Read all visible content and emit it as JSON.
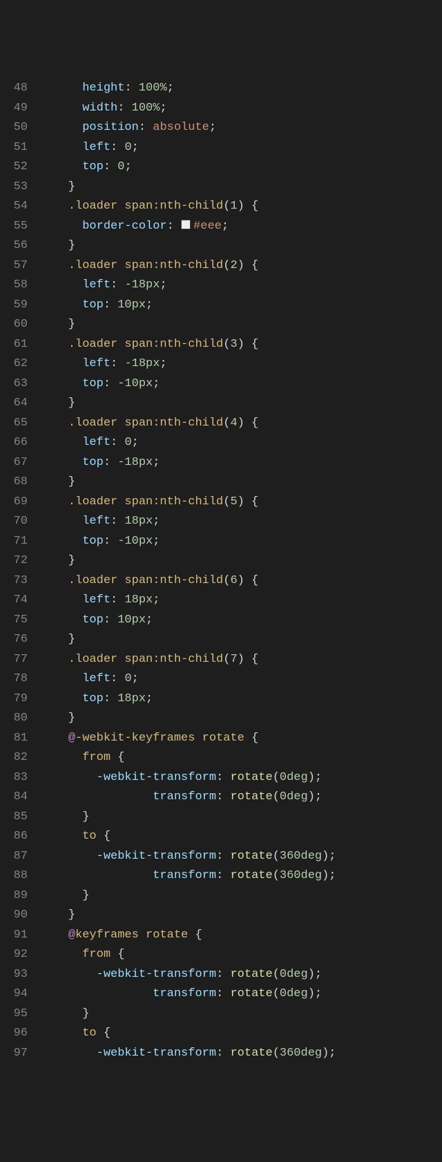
{
  "lines": [
    {
      "n": 48,
      "tokens": [
        {
          "t": "      ",
          "c": "punc"
        },
        {
          "t": "height",
          "c": "prop"
        },
        {
          "t": ": ",
          "c": "punc"
        },
        {
          "t": "100",
          "c": "num"
        },
        {
          "t": "%",
          "c": "unit"
        },
        {
          "t": ";",
          "c": "punc"
        }
      ]
    },
    {
      "n": 49,
      "tokens": [
        {
          "t": "      ",
          "c": "punc"
        },
        {
          "t": "width",
          "c": "prop"
        },
        {
          "t": ": ",
          "c": "punc"
        },
        {
          "t": "100",
          "c": "num"
        },
        {
          "t": "%",
          "c": "unit"
        },
        {
          "t": ";",
          "c": "punc"
        }
      ]
    },
    {
      "n": 50,
      "tokens": [
        {
          "t": "      ",
          "c": "punc"
        },
        {
          "t": "position",
          "c": "prop"
        },
        {
          "t": ": ",
          "c": "punc"
        },
        {
          "t": "absolute",
          "c": "val"
        },
        {
          "t": ";",
          "c": "punc"
        }
      ]
    },
    {
      "n": 51,
      "tokens": [
        {
          "t": "      ",
          "c": "punc"
        },
        {
          "t": "left",
          "c": "prop"
        },
        {
          "t": ": ",
          "c": "punc"
        },
        {
          "t": "0",
          "c": "num"
        },
        {
          "t": ";",
          "c": "punc"
        }
      ]
    },
    {
      "n": 52,
      "tokens": [
        {
          "t": "      ",
          "c": "punc"
        },
        {
          "t": "top",
          "c": "prop"
        },
        {
          "t": ": ",
          "c": "punc"
        },
        {
          "t": "0",
          "c": "num"
        },
        {
          "t": ";",
          "c": "punc"
        }
      ]
    },
    {
      "n": 53,
      "tokens": [
        {
          "t": "    }",
          "c": "punc"
        }
      ]
    },
    {
      "n": 54,
      "tokens": [
        {
          "t": "    ",
          "c": "punc"
        },
        {
          "t": ".loader span:nth-child",
          "c": "sel"
        },
        {
          "t": "(",
          "c": "punc"
        },
        {
          "t": "1",
          "c": "num"
        },
        {
          "t": ")",
          "c": "punc"
        },
        {
          "t": " {",
          "c": "punc"
        }
      ]
    },
    {
      "n": 55,
      "tokens": [
        {
          "t": "      ",
          "c": "punc"
        },
        {
          "t": "border-color",
          "c": "prop"
        },
        {
          "t": ": ",
          "c": "punc"
        },
        {
          "t": "",
          "c": "colorbox"
        },
        {
          "t": "#eee",
          "c": "hex"
        },
        {
          "t": ";",
          "c": "punc"
        }
      ]
    },
    {
      "n": 56,
      "tokens": [
        {
          "t": "    }",
          "c": "punc"
        }
      ]
    },
    {
      "n": 57,
      "tokens": [
        {
          "t": "    ",
          "c": "punc"
        },
        {
          "t": ".loader span:nth-child",
          "c": "sel"
        },
        {
          "t": "(",
          "c": "punc"
        },
        {
          "t": "2",
          "c": "num"
        },
        {
          "t": ")",
          "c": "punc"
        },
        {
          "t": " {",
          "c": "punc"
        }
      ]
    },
    {
      "n": 58,
      "tokens": [
        {
          "t": "      ",
          "c": "punc"
        },
        {
          "t": "left",
          "c": "prop"
        },
        {
          "t": ": ",
          "c": "punc"
        },
        {
          "t": "-18",
          "c": "num"
        },
        {
          "t": "px",
          "c": "unit"
        },
        {
          "t": ";",
          "c": "punc"
        }
      ]
    },
    {
      "n": 59,
      "tokens": [
        {
          "t": "      ",
          "c": "punc"
        },
        {
          "t": "top",
          "c": "prop"
        },
        {
          "t": ": ",
          "c": "punc"
        },
        {
          "t": "10",
          "c": "num"
        },
        {
          "t": "px",
          "c": "unit"
        },
        {
          "t": ";",
          "c": "punc"
        }
      ]
    },
    {
      "n": 60,
      "tokens": [
        {
          "t": "    }",
          "c": "punc"
        }
      ]
    },
    {
      "n": 61,
      "tokens": [
        {
          "t": "    ",
          "c": "punc"
        },
        {
          "t": ".loader span:nth-child",
          "c": "sel"
        },
        {
          "t": "(",
          "c": "punc"
        },
        {
          "t": "3",
          "c": "num"
        },
        {
          "t": ")",
          "c": "punc"
        },
        {
          "t": " {",
          "c": "punc"
        }
      ]
    },
    {
      "n": 62,
      "tokens": [
        {
          "t": "      ",
          "c": "punc"
        },
        {
          "t": "left",
          "c": "prop"
        },
        {
          "t": ": ",
          "c": "punc"
        },
        {
          "t": "-18",
          "c": "num"
        },
        {
          "t": "px",
          "c": "unit"
        },
        {
          "t": ";",
          "c": "punc"
        }
      ]
    },
    {
      "n": 63,
      "tokens": [
        {
          "t": "      ",
          "c": "punc"
        },
        {
          "t": "top",
          "c": "prop"
        },
        {
          "t": ": ",
          "c": "punc"
        },
        {
          "t": "-10",
          "c": "num"
        },
        {
          "t": "px",
          "c": "unit"
        },
        {
          "t": ";",
          "c": "punc"
        }
      ]
    },
    {
      "n": 64,
      "tokens": [
        {
          "t": "    }",
          "c": "punc"
        }
      ]
    },
    {
      "n": 65,
      "tokens": [
        {
          "t": "    ",
          "c": "punc"
        },
        {
          "t": ".loader span:nth-child",
          "c": "sel"
        },
        {
          "t": "(",
          "c": "punc"
        },
        {
          "t": "4",
          "c": "num"
        },
        {
          "t": ")",
          "c": "punc"
        },
        {
          "t": " {",
          "c": "punc"
        }
      ]
    },
    {
      "n": 66,
      "tokens": [
        {
          "t": "      ",
          "c": "punc"
        },
        {
          "t": "left",
          "c": "prop"
        },
        {
          "t": ": ",
          "c": "punc"
        },
        {
          "t": "0",
          "c": "num"
        },
        {
          "t": ";",
          "c": "punc"
        }
      ]
    },
    {
      "n": 67,
      "tokens": [
        {
          "t": "      ",
          "c": "punc"
        },
        {
          "t": "top",
          "c": "prop"
        },
        {
          "t": ": ",
          "c": "punc"
        },
        {
          "t": "-18",
          "c": "num"
        },
        {
          "t": "px",
          "c": "unit"
        },
        {
          "t": ";",
          "c": "punc"
        }
      ]
    },
    {
      "n": 68,
      "tokens": [
        {
          "t": "    }",
          "c": "punc"
        }
      ]
    },
    {
      "n": 69,
      "tokens": [
        {
          "t": "    ",
          "c": "punc"
        },
        {
          "t": ".loader span:nth-child",
          "c": "sel"
        },
        {
          "t": "(",
          "c": "punc"
        },
        {
          "t": "5",
          "c": "num"
        },
        {
          "t": ")",
          "c": "punc"
        },
        {
          "t": " {",
          "c": "punc"
        }
      ]
    },
    {
      "n": 70,
      "tokens": [
        {
          "t": "      ",
          "c": "punc"
        },
        {
          "t": "left",
          "c": "prop"
        },
        {
          "t": ": ",
          "c": "punc"
        },
        {
          "t": "18",
          "c": "num"
        },
        {
          "t": "px",
          "c": "unit"
        },
        {
          "t": ";",
          "c": "punc"
        }
      ]
    },
    {
      "n": 71,
      "tokens": [
        {
          "t": "      ",
          "c": "punc"
        },
        {
          "t": "top",
          "c": "prop"
        },
        {
          "t": ": ",
          "c": "punc"
        },
        {
          "t": "-10",
          "c": "num"
        },
        {
          "t": "px",
          "c": "unit"
        },
        {
          "t": ";",
          "c": "punc"
        }
      ]
    },
    {
      "n": 72,
      "tokens": [
        {
          "t": "    }",
          "c": "punc"
        }
      ]
    },
    {
      "n": 73,
      "tokens": [
        {
          "t": "    ",
          "c": "punc"
        },
        {
          "t": ".loader span:nth-child",
          "c": "sel"
        },
        {
          "t": "(",
          "c": "punc"
        },
        {
          "t": "6",
          "c": "num"
        },
        {
          "t": ")",
          "c": "punc"
        },
        {
          "t": " {",
          "c": "punc"
        }
      ]
    },
    {
      "n": 74,
      "tokens": [
        {
          "t": "      ",
          "c": "punc"
        },
        {
          "t": "left",
          "c": "prop"
        },
        {
          "t": ": ",
          "c": "punc"
        },
        {
          "t": "18",
          "c": "num"
        },
        {
          "t": "px",
          "c": "unit"
        },
        {
          "t": ";",
          "c": "punc"
        }
      ]
    },
    {
      "n": 75,
      "tokens": [
        {
          "t": "      ",
          "c": "punc"
        },
        {
          "t": "top",
          "c": "prop"
        },
        {
          "t": ": ",
          "c": "punc"
        },
        {
          "t": "10",
          "c": "num"
        },
        {
          "t": "px",
          "c": "unit"
        },
        {
          "t": ";",
          "c": "punc"
        }
      ]
    },
    {
      "n": 76,
      "tokens": [
        {
          "t": "    }",
          "c": "punc"
        }
      ]
    },
    {
      "n": 77,
      "tokens": [
        {
          "t": "    ",
          "c": "punc"
        },
        {
          "t": ".loader span:nth-child",
          "c": "sel"
        },
        {
          "t": "(",
          "c": "punc"
        },
        {
          "t": "7",
          "c": "num"
        },
        {
          "t": ")",
          "c": "punc"
        },
        {
          "t": " {",
          "c": "punc"
        }
      ]
    },
    {
      "n": 78,
      "tokens": [
        {
          "t": "      ",
          "c": "punc"
        },
        {
          "t": "left",
          "c": "prop"
        },
        {
          "t": ": ",
          "c": "punc"
        },
        {
          "t": "0",
          "c": "num"
        },
        {
          "t": ";",
          "c": "punc"
        }
      ]
    },
    {
      "n": 79,
      "tokens": [
        {
          "t": "      ",
          "c": "punc"
        },
        {
          "t": "top",
          "c": "prop"
        },
        {
          "t": ": ",
          "c": "punc"
        },
        {
          "t": "18",
          "c": "num"
        },
        {
          "t": "px",
          "c": "unit"
        },
        {
          "t": ";",
          "c": "punc"
        }
      ]
    },
    {
      "n": 80,
      "tokens": [
        {
          "t": "    }",
          "c": "punc"
        }
      ]
    },
    {
      "n": 81,
      "tokens": [
        {
          "t": "    ",
          "c": "punc"
        },
        {
          "t": "@",
          "c": "at"
        },
        {
          "t": "-webkit-keyframes",
          "c": "sel"
        },
        {
          "t": " ",
          "c": "punc"
        },
        {
          "t": "rotate",
          "c": "sel"
        },
        {
          "t": " {",
          "c": "punc"
        }
      ]
    },
    {
      "n": 82,
      "tokens": [
        {
          "t": "      ",
          "c": "punc"
        },
        {
          "t": "from",
          "c": "sel"
        },
        {
          "t": " {",
          "c": "punc"
        }
      ]
    },
    {
      "n": 83,
      "tokens": [
        {
          "t": "        ",
          "c": "punc"
        },
        {
          "t": "-webkit-transform",
          "c": "prop"
        },
        {
          "t": ": ",
          "c": "punc"
        },
        {
          "t": "rotate",
          "c": "fn"
        },
        {
          "t": "(",
          "c": "punc"
        },
        {
          "t": "0",
          "c": "num"
        },
        {
          "t": "deg",
          "c": "unit"
        },
        {
          "t": ");",
          "c": "punc"
        }
      ]
    },
    {
      "n": 84,
      "tokens": [
        {
          "t": "                ",
          "c": "punc"
        },
        {
          "t": "transform",
          "c": "prop"
        },
        {
          "t": ": ",
          "c": "punc"
        },
        {
          "t": "rotate",
          "c": "fn"
        },
        {
          "t": "(",
          "c": "punc"
        },
        {
          "t": "0",
          "c": "num"
        },
        {
          "t": "deg",
          "c": "unit"
        },
        {
          "t": ");",
          "c": "punc"
        }
      ]
    },
    {
      "n": 85,
      "tokens": [
        {
          "t": "      }",
          "c": "punc"
        }
      ]
    },
    {
      "n": 86,
      "tokens": [
        {
          "t": "      ",
          "c": "punc"
        },
        {
          "t": "to",
          "c": "sel"
        },
        {
          "t": " {",
          "c": "punc"
        }
      ]
    },
    {
      "n": 87,
      "tokens": [
        {
          "t": "        ",
          "c": "punc"
        },
        {
          "t": "-webkit-transform",
          "c": "prop"
        },
        {
          "t": ": ",
          "c": "punc"
        },
        {
          "t": "rotate",
          "c": "fn"
        },
        {
          "t": "(",
          "c": "punc"
        },
        {
          "t": "360",
          "c": "num"
        },
        {
          "t": "deg",
          "c": "unit"
        },
        {
          "t": ");",
          "c": "punc"
        }
      ]
    },
    {
      "n": 88,
      "tokens": [
        {
          "t": "                ",
          "c": "punc"
        },
        {
          "t": "transform",
          "c": "prop"
        },
        {
          "t": ": ",
          "c": "punc"
        },
        {
          "t": "rotate",
          "c": "fn"
        },
        {
          "t": "(",
          "c": "punc"
        },
        {
          "t": "360",
          "c": "num"
        },
        {
          "t": "deg",
          "c": "unit"
        },
        {
          "t": ");",
          "c": "punc"
        }
      ]
    },
    {
      "n": 89,
      "tokens": [
        {
          "t": "      }",
          "c": "punc"
        }
      ]
    },
    {
      "n": 90,
      "tokens": [
        {
          "t": "    }",
          "c": "punc"
        }
      ]
    },
    {
      "n": 91,
      "tokens": [
        {
          "t": "    ",
          "c": "punc"
        },
        {
          "t": "@",
          "c": "at"
        },
        {
          "t": "keyframes",
          "c": "sel"
        },
        {
          "t": " ",
          "c": "punc"
        },
        {
          "t": "rotate",
          "c": "sel"
        },
        {
          "t": " {",
          "c": "punc"
        }
      ]
    },
    {
      "n": 92,
      "tokens": [
        {
          "t": "      ",
          "c": "punc"
        },
        {
          "t": "from",
          "c": "sel"
        },
        {
          "t": " {",
          "c": "punc"
        }
      ]
    },
    {
      "n": 93,
      "tokens": [
        {
          "t": "        ",
          "c": "punc"
        },
        {
          "t": "-webkit-transform",
          "c": "prop"
        },
        {
          "t": ": ",
          "c": "punc"
        },
        {
          "t": "rotate",
          "c": "fn"
        },
        {
          "t": "(",
          "c": "punc"
        },
        {
          "t": "0",
          "c": "num"
        },
        {
          "t": "deg",
          "c": "unit"
        },
        {
          "t": ");",
          "c": "punc"
        }
      ]
    },
    {
      "n": 94,
      "tokens": [
        {
          "t": "                ",
          "c": "punc"
        },
        {
          "t": "transform",
          "c": "prop"
        },
        {
          "t": ": ",
          "c": "punc"
        },
        {
          "t": "rotate",
          "c": "fn"
        },
        {
          "t": "(",
          "c": "punc"
        },
        {
          "t": "0",
          "c": "num"
        },
        {
          "t": "deg",
          "c": "unit"
        },
        {
          "t": ");",
          "c": "punc"
        }
      ]
    },
    {
      "n": 95,
      "tokens": [
        {
          "t": "      }",
          "c": "punc"
        }
      ]
    },
    {
      "n": 96,
      "tokens": [
        {
          "t": "      ",
          "c": "punc"
        },
        {
          "t": "to",
          "c": "sel"
        },
        {
          "t": " {",
          "c": "punc"
        }
      ]
    },
    {
      "n": 97,
      "tokens": [
        {
          "t": "        ",
          "c": "punc"
        },
        {
          "t": "-webkit-transform",
          "c": "prop"
        },
        {
          "t": ": ",
          "c": "punc"
        },
        {
          "t": "rotate",
          "c": "fn"
        },
        {
          "t": "(",
          "c": "punc"
        },
        {
          "t": "360",
          "c": "num"
        },
        {
          "t": "deg",
          "c": "unit"
        },
        {
          "t": ");",
          "c": "punc"
        }
      ]
    }
  ]
}
